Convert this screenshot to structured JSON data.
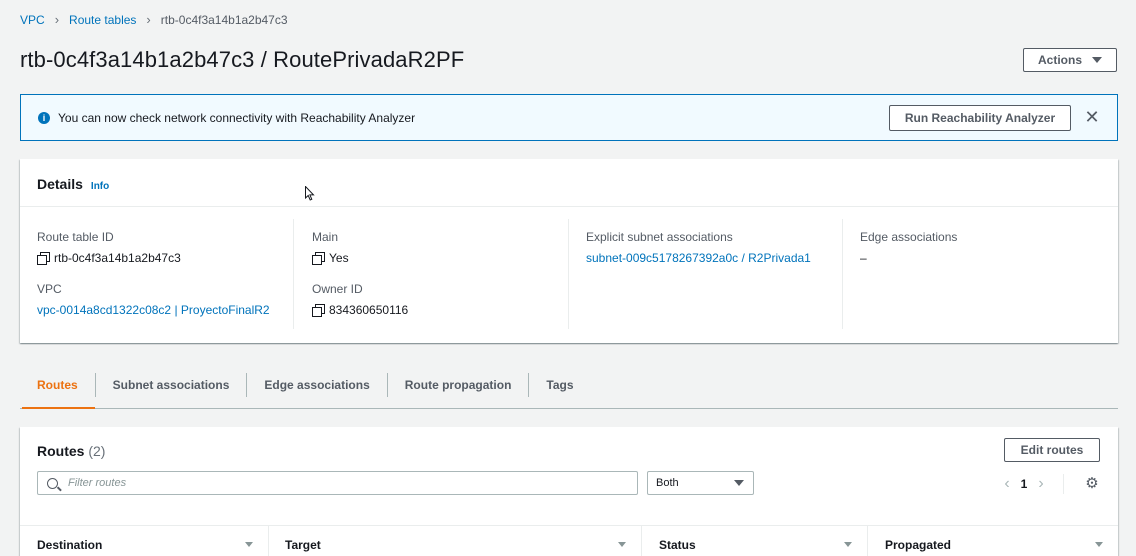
{
  "breadcrumb": {
    "items": [
      "VPC",
      "Route tables"
    ],
    "current": "rtb-0c4f3a14b1a2b47c3"
  },
  "header": {
    "title": "rtb-0c4f3a14b1a2b47c3 / RoutePrivadaR2PF",
    "actions_label": "Actions"
  },
  "flash": {
    "message": "You can now check network connectivity with Reachability Analyzer",
    "button_label": "Run Reachability Analyzer",
    "info_icon": "i",
    "close_icon": "✕"
  },
  "details": {
    "title": "Details",
    "info_label": "Info",
    "route_table_id": {
      "label": "Route table ID",
      "value": "rtb-0c4f3a14b1a2b47c3"
    },
    "vpc": {
      "label": "VPC",
      "value": "vpc-0014a8cd1322c08c2 | ProyectoFinalR2"
    },
    "main": {
      "label": "Main",
      "value": "Yes"
    },
    "owner_id": {
      "label": "Owner ID",
      "value": "834360650116"
    },
    "explicit_subnet": {
      "label": "Explicit subnet associations",
      "value": "subnet-009c5178267392a0c / R2Privada1"
    },
    "edge": {
      "label": "Edge associations",
      "value": "–"
    }
  },
  "tabs": [
    {
      "label": "Routes"
    },
    {
      "label": "Subnet associations"
    },
    {
      "label": "Edge associations"
    },
    {
      "label": "Route propagation"
    },
    {
      "label": "Tags"
    }
  ],
  "routes": {
    "title": "Routes",
    "count": "(2)",
    "edit_label": "Edit routes",
    "filter_placeholder": "Filter routes",
    "select_value": "Both",
    "page": "1",
    "prev_icon": "‹",
    "next_icon": "›",
    "gear_icon": "⚙",
    "columns": [
      "Destination",
      "Target",
      "Status",
      "Propagated"
    ]
  },
  "colors": {
    "accent": "#ec7211",
    "link": "#0073bb",
    "flash_bg": "#f1faff"
  }
}
